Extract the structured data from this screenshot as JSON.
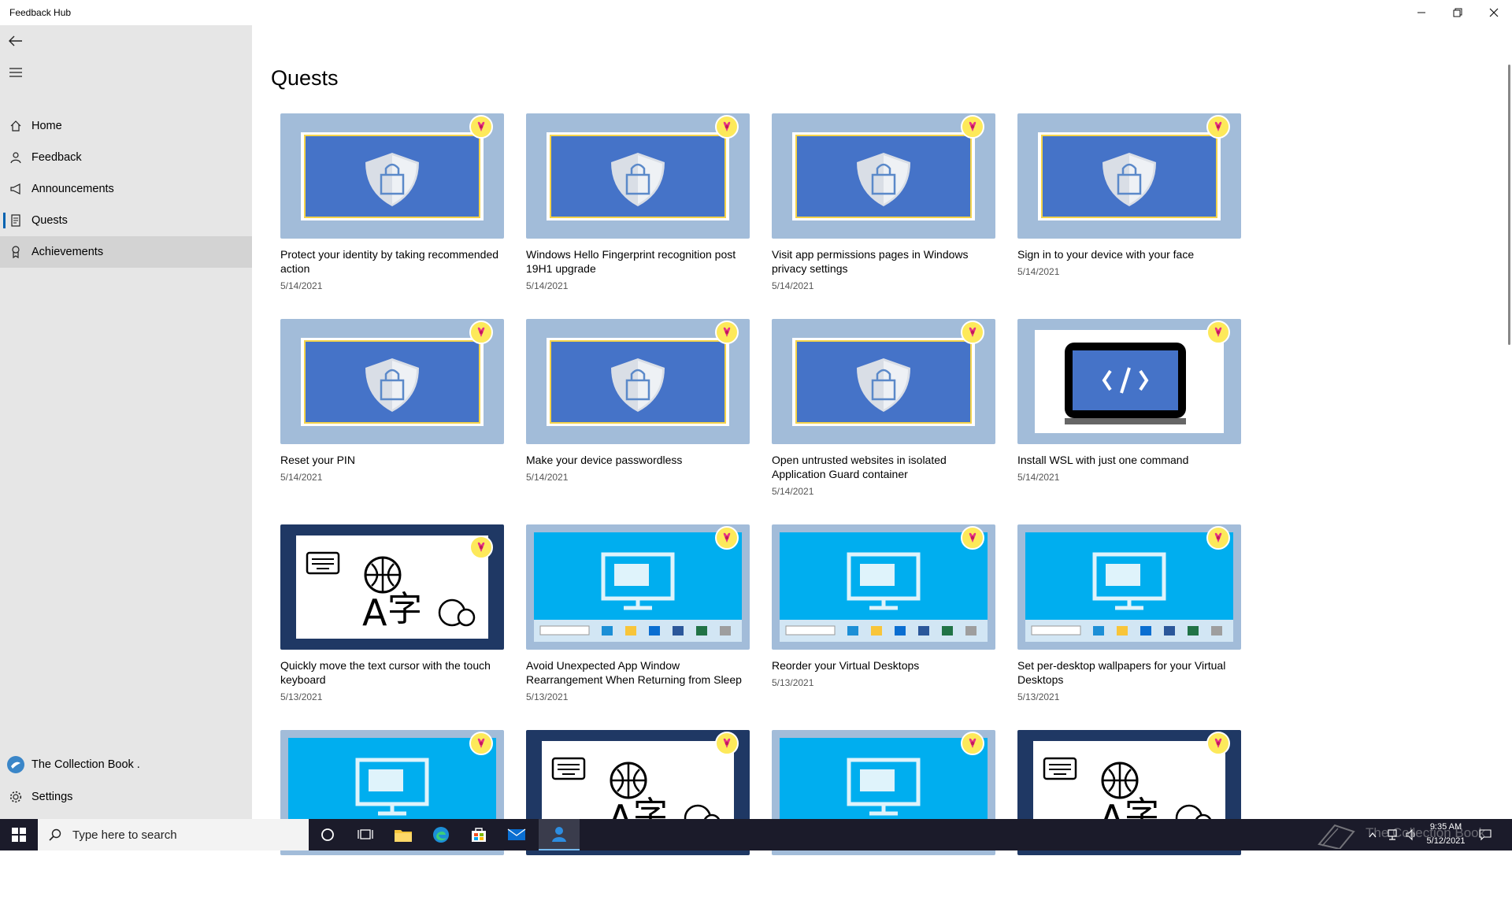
{
  "window": {
    "title": "Feedback Hub"
  },
  "sidebar": {
    "items": [
      {
        "label": "Home",
        "icon": "home-icon"
      },
      {
        "label": "Feedback",
        "icon": "feedback-icon"
      },
      {
        "label": "Announcements",
        "icon": "megaphone-icon"
      },
      {
        "label": "Quests",
        "icon": "quest-icon",
        "selected": true
      },
      {
        "label": "Achievements",
        "icon": "ribbon-icon",
        "hovered": true
      }
    ],
    "account_label": "The Collection Book .",
    "settings_label": "Settings"
  },
  "main": {
    "title": "Quests",
    "quests": [
      {
        "title": "Protect your identity by taking recommended action",
        "date": "5/14/2021",
        "thumb": "security"
      },
      {
        "title": "Windows Hello Fingerprint recognition post 19H1 upgrade",
        "date": "5/14/2021",
        "thumb": "security"
      },
      {
        "title": "Visit app permissions pages in Windows privacy settings",
        "date": "5/14/2021",
        "thumb": "security"
      },
      {
        "title": "Sign in to your device with your face",
        "date": "5/14/2021",
        "thumb": "security"
      },
      {
        "title": "Reset your PIN",
        "date": "5/14/2021",
        "thumb": "security"
      },
      {
        "title": "Make your device passwordless",
        "date": "5/14/2021",
        "thumb": "security"
      },
      {
        "title": "Open untrusted websites in isolated Application Guard container",
        "date": "5/14/2021",
        "thumb": "security"
      },
      {
        "title": "Install WSL with just one command",
        "date": "5/14/2021",
        "thumb": "code"
      },
      {
        "title": "Quickly move the text cursor with the touch keyboard",
        "date": "5/13/2021",
        "thumb": "keyboard"
      },
      {
        "title": "Avoid Unexpected App Window Rearrangement When Returning from Sleep",
        "date": "5/13/2021",
        "thumb": "desktop"
      },
      {
        "title": "Reorder your Virtual Desktops",
        "date": "5/13/2021",
        "thumb": "desktop"
      },
      {
        "title": "Set per-desktop wallpapers for your Virtual Desktops",
        "date": "5/13/2021",
        "thumb": "desktop"
      },
      {
        "title": "",
        "date": "",
        "thumb": "desktop"
      },
      {
        "title": "",
        "date": "",
        "thumb": "keyboard"
      },
      {
        "title": "",
        "date": "",
        "thumb": "desktop"
      },
      {
        "title": "",
        "date": "",
        "thumb": "keyboard"
      }
    ]
  },
  "taskbar": {
    "search_placeholder": "Type here to search",
    "clock_time": "9:35 AM",
    "clock_date": "5/12/2021",
    "watermark": "The Collection Book"
  },
  "colors": {
    "sidebar_bg": "#e6e6e6",
    "security_frame": "#a2bcd9",
    "security_inner": "#4573c8",
    "desktop_bg": "#00aeef",
    "keyboard_frame": "#1f3864",
    "badge": "#fde95a",
    "taskbar": "#1b1b2a"
  }
}
